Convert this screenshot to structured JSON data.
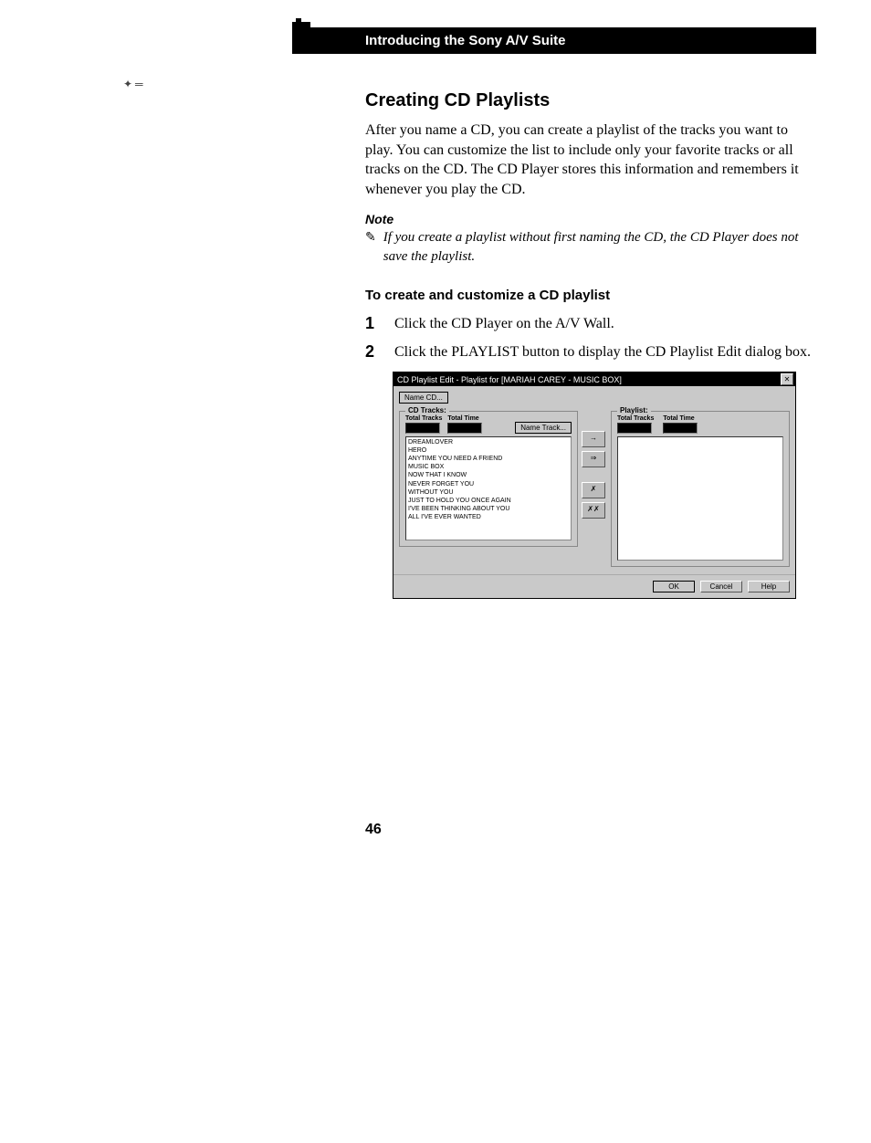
{
  "header": {
    "title": "Introducing the Sony A/V Suite"
  },
  "section": {
    "heading": "Creating CD Playlists",
    "intro": "After you name a CD, you can create a playlist of the tracks you want to play. You can customize the list to include only your favorite tracks or all tracks on the CD. The CD Player stores this information and remembers it whenever you play the CD.",
    "note_label": "Note",
    "note_icon": "✎",
    "note_text": "If you create a playlist without first naming the CD, the CD Player does not save the playlist.",
    "subheading": "To create and customize a CD playlist",
    "steps": [
      {
        "num": "1",
        "text": "Click the CD Player on the A/V Wall."
      },
      {
        "num": "2",
        "text": "Click the PLAYLIST button to display the CD Playlist Edit dialog box."
      }
    ]
  },
  "dialog": {
    "title": "CD Playlist Edit - Playlist for [MARIAH CAREY - MUSIC BOX]",
    "close": "✕",
    "name_cd_btn": "Name CD...",
    "cd_tracks_legend": "CD Tracks:",
    "name_track_btn": "Name Track...",
    "label_total_tracks": "Total Tracks",
    "label_total_time": "Total Time",
    "playlist_legend": "Playlist:",
    "tracks": [
      "DREAMLOVER",
      "HERO",
      "ANYTIME YOU NEED A FRIEND",
      "MUSIC BOX",
      "NOW THAT I KNOW",
      "NEVER FORGET YOU",
      "WITHOUT YOU",
      "JUST TO HOLD YOU ONCE AGAIN",
      "I'VE BEEN THINKING ABOUT YOU",
      "ALL I'VE EVER WANTED"
    ],
    "mid_buttons": {
      "add_one": "→",
      "add_all": "⇒",
      "rem_one": "✗",
      "rem_all": "✗✗"
    },
    "footer": {
      "ok": "OK",
      "cancel": "Cancel",
      "help": "Help"
    }
  },
  "page_number": "46"
}
